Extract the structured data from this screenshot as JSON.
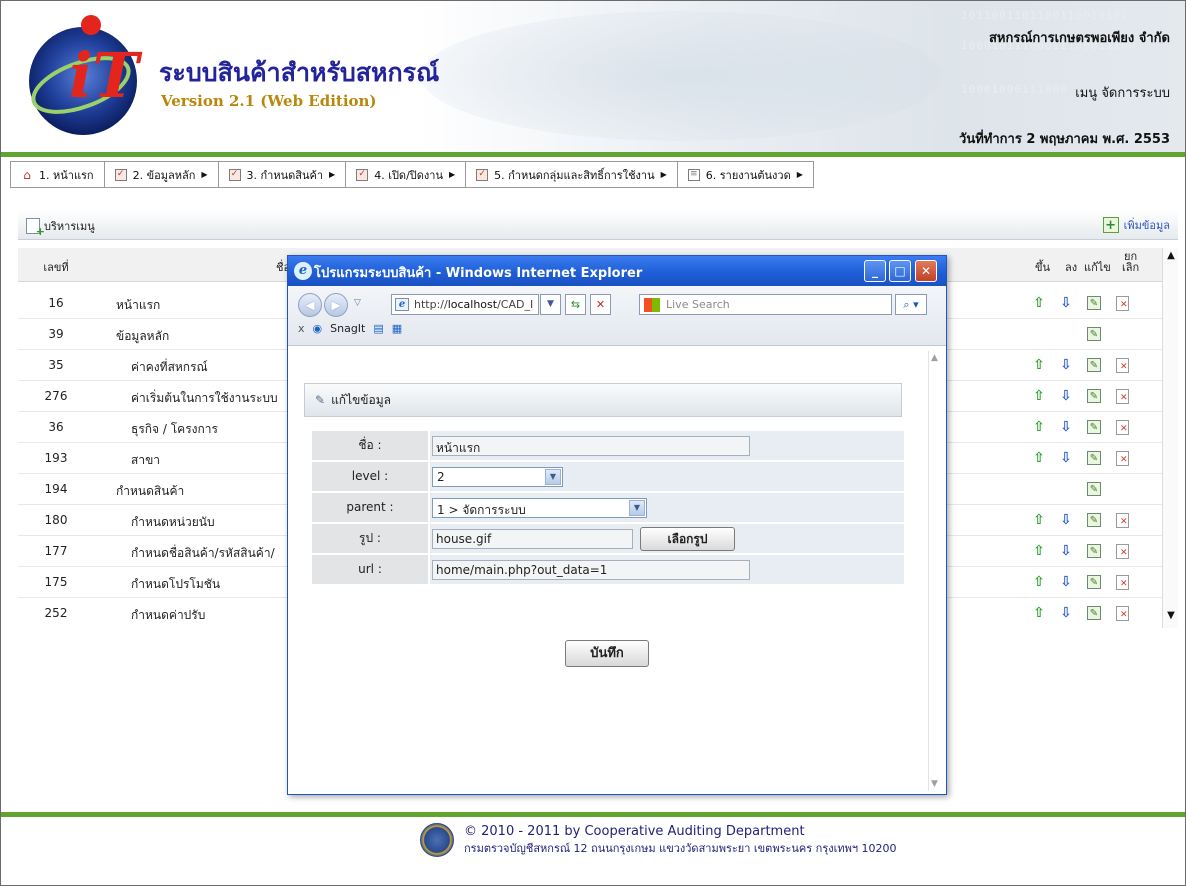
{
  "header": {
    "app_title": "ระบบสินค้าสำหรับสหกรณ์",
    "version": "Version 2.1 (Web Edition)",
    "coop_name": "สหกรณ์การเกษตรพอเพียง จำกัด",
    "user_menu": "เมนู จัดการระบบ",
    "work_date": "วันที่ทำการ 2 พฤษภาคม พ.ศ. 2553",
    "logo_letters": "iT",
    "logo_ring_text": "Full Pack Accounting Software : FAS",
    "bits": [
      "1011001101100110010101",
      "10001011100011100011100",
      "10001000111000"
    ]
  },
  "menubar": [
    {
      "label": "1. หน้าแรก",
      "icon": "home-icon",
      "submenu": false
    },
    {
      "label": "2. ข้อมูลหลัก",
      "icon": "checkbox-icon",
      "submenu": true
    },
    {
      "label": "3. กำหนดสินค้า",
      "icon": "checkbox-icon",
      "submenu": true
    },
    {
      "label": "4. เปิด/ปิดงาน",
      "icon": "checkbox-icon",
      "submenu": true
    },
    {
      "label": "5. กำหนดกลุ่มและสิทธิ์การใช้งาน",
      "icon": "checkbox-icon",
      "submenu": true
    },
    {
      "label": "6. รายงานต้นงวด",
      "icon": "document-icon",
      "submenu": true
    }
  ],
  "panel": {
    "title": "บริหารเมนู",
    "add_label": "เพิ่มข้อมูล"
  },
  "columns": {
    "no": "เลขที่",
    "name": "ชื่อ",
    "up": "ขึ้น",
    "down": "ลง",
    "edit": "แก้ไข",
    "cancel_line1": "ยก",
    "cancel_line2": "เลิก"
  },
  "rows": [
    {
      "no": "16",
      "name": "หน้าแรก",
      "level": 1,
      "up": true,
      "down": true,
      "edit": true,
      "del": true
    },
    {
      "no": "39",
      "name": "ข้อมูลหลัก",
      "level": 1,
      "up": false,
      "down": false,
      "edit": true,
      "del": false
    },
    {
      "no": "35",
      "name": "ค่าคงที่สหกรณ์",
      "level": 2,
      "up": true,
      "down": true,
      "edit": true,
      "del": true
    },
    {
      "no": "276",
      "name": "ค่าเริ่มต้นในการใช้งานระบบ",
      "level": 2,
      "up": true,
      "down": true,
      "edit": true,
      "del": true
    },
    {
      "no": "36",
      "name": "ธุรกิจ / โครงการ",
      "level": 2,
      "up": true,
      "down": true,
      "edit": true,
      "del": true
    },
    {
      "no": "193",
      "name": "สาขา",
      "level": 2,
      "up": true,
      "down": true,
      "edit": true,
      "del": true
    },
    {
      "no": "194",
      "name": "กำหนดสินค้า",
      "level": 1,
      "up": false,
      "down": false,
      "edit": true,
      "del": false
    },
    {
      "no": "180",
      "name": "กำหนดหน่วยนับ",
      "level": 2,
      "up": true,
      "down": true,
      "edit": true,
      "del": true
    },
    {
      "no": "177",
      "name": "กำหนดชื่อสินค้า/รหัสสินค้า/",
      "level": 2,
      "up": true,
      "down": true,
      "edit": true,
      "del": true
    },
    {
      "no": "175",
      "name": "กำหนดโปรโมชัน",
      "level": 2,
      "up": true,
      "down": true,
      "edit": true,
      "del": true
    },
    {
      "no": "252",
      "name": "กำหนดค่าปรับ",
      "level": 2,
      "up": true,
      "down": true,
      "edit": true,
      "del": true
    }
  ],
  "popup": {
    "title": "โปรแกรมระบบสินค้า - Windows Internet Explorer",
    "address_prefix": "http://",
    "address_host": "localhost",
    "address_path": "/CAD_I",
    "search_placeholder": "Live Search",
    "snagit_label": "SnagIt",
    "close_x": "x",
    "form_title": "แก้ไขข้อมูล",
    "fields": {
      "name_label": "ชื่อ :",
      "name_value": "หน้าแรก",
      "level_label": "level :",
      "level_value": "2",
      "parent_label": "parent :",
      "parent_value": "1 > จัดการระบบ",
      "image_label": "รูป :",
      "image_value": "house.gif",
      "pick_image_button": "เลือกรูป",
      "url_label": "url :",
      "url_value": "home/main.php?out_data=1"
    },
    "save_button": "บันทึก"
  },
  "footer": {
    "line1": "© 2010 - 2011  by Cooperative Auditing Department",
    "line2": "กรมตรวจบัญชีสหกรณ์ 12 ถนนกรุงเกษม แขวงวัดสามพระยา เขตพระนคร กรุงเทพฯ 10200"
  },
  "colors": {
    "accent_green": "#62a432",
    "title_blue": "#23239b",
    "version_gold": "#b8870c",
    "ie_title_blue": "#1f5ed6"
  }
}
